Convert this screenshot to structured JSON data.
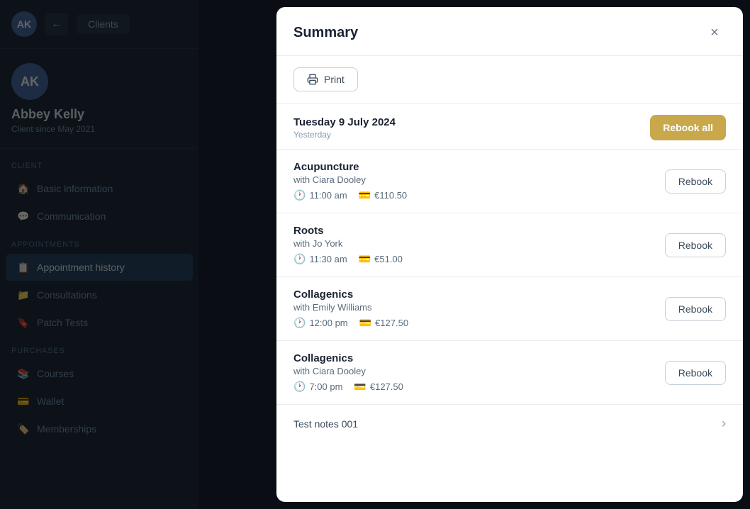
{
  "app": {
    "clients_label": "Clients"
  },
  "client": {
    "initials": "AK",
    "name": "Abbey Kelly",
    "since": "Client since May 2021"
  },
  "sidebar": {
    "sections": [
      {
        "label": "Client",
        "items": [
          {
            "id": "basic-information",
            "label": "Basic information",
            "icon": "🏠"
          },
          {
            "id": "communication",
            "label": "Communication",
            "icon": "💬"
          }
        ]
      },
      {
        "label": "Appointments",
        "items": [
          {
            "id": "appointment-history",
            "label": "Appointment history",
            "icon": "📋",
            "active": true
          }
        ]
      },
      {
        "label": "",
        "items": [
          {
            "id": "consultations",
            "label": "Consultations",
            "icon": "📁"
          },
          {
            "id": "patch-tests",
            "label": "Patch Tests",
            "icon": "🔖"
          }
        ]
      },
      {
        "label": "Purchases",
        "items": [
          {
            "id": "courses",
            "label": "Courses",
            "icon": "📚"
          },
          {
            "id": "wallet",
            "label": "Wallet",
            "icon": "💳"
          },
          {
            "id": "memberships",
            "label": "Memberships",
            "icon": "🏷️"
          }
        ]
      }
    ]
  },
  "modal": {
    "title": "Summary",
    "print_label": "Print",
    "close_icon": "×",
    "date": "Tuesday 9 July 2024",
    "date_sub": "Yesterday",
    "rebook_all_label": "Rebook all",
    "appointments": [
      {
        "id": 1,
        "name": "Acupuncture",
        "with": "with Ciara Dooley",
        "time": "11:00 am",
        "price": "€110.50",
        "rebook_label": "Rebook"
      },
      {
        "id": 2,
        "name": "Roots",
        "with": "with Jo York",
        "time": "11:30 am",
        "price": "€51.00",
        "rebook_label": "Rebook"
      },
      {
        "id": 3,
        "name": "Collagenics",
        "with": "with Emily Williams",
        "time": "12:00 pm",
        "price": "€127.50",
        "rebook_label": "Rebook"
      },
      {
        "id": 4,
        "name": "Collagenics",
        "with": "with Ciara Dooley",
        "time": "7:00 pm",
        "price": "€127.50",
        "rebook_label": "Rebook"
      }
    ],
    "notes": {
      "label": "Test notes 001"
    }
  }
}
